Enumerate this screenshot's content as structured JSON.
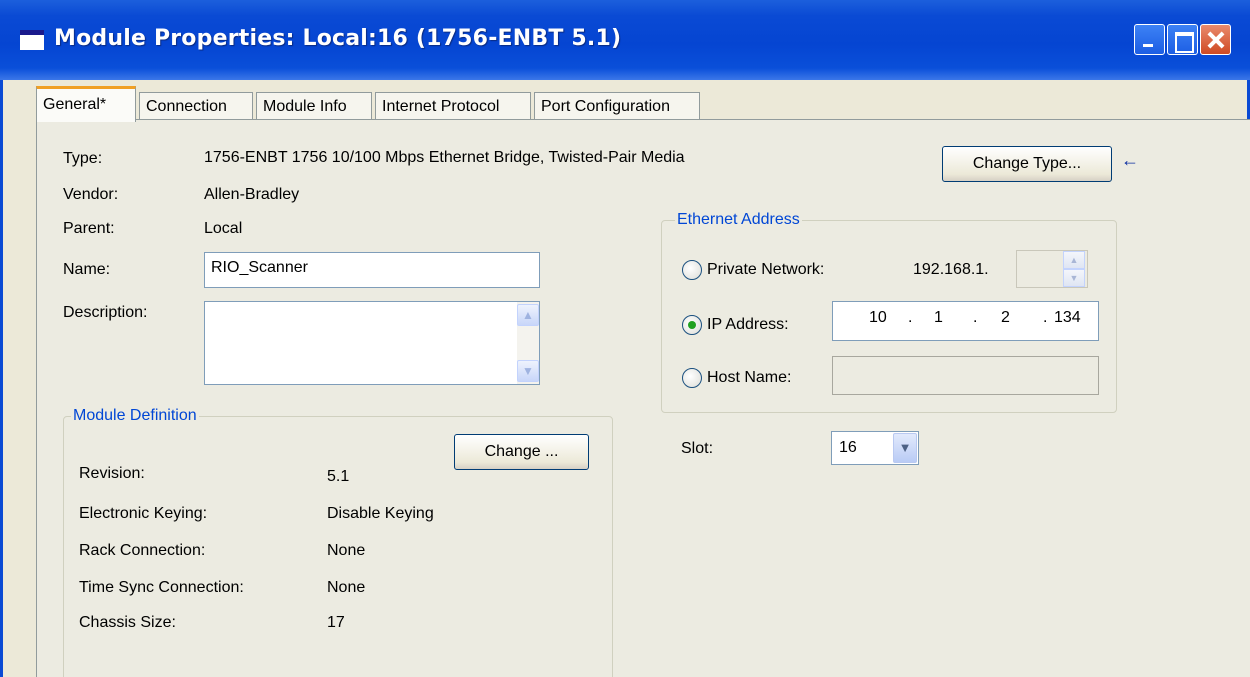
{
  "window": {
    "title": "Module Properties: Local:16 (1756-ENBT 5.1)"
  },
  "tabs": [
    {
      "label": "General*"
    },
    {
      "label": "Connection"
    },
    {
      "label": "Module Info"
    },
    {
      "label": "Internet Protocol"
    },
    {
      "label": "Port Configuration"
    }
  ],
  "general": {
    "type_label": "Type:",
    "type_value": "1756-ENBT 1756 10/100 Mbps Ethernet Bridge, Twisted-Pair Media",
    "vendor_label": "Vendor:",
    "vendor_value": "Allen-Bradley",
    "parent_label": "Parent:",
    "parent_value": "Local",
    "name_label": "Name:",
    "name_value": "RIO_Scanner",
    "description_label": "Description:",
    "description_value": "",
    "change_type_button": "Change Type...",
    "arrow_glyph": "←"
  },
  "module_definition": {
    "title": "Module Definition",
    "change_button": "Change ...",
    "rows": [
      {
        "label": "Revision:",
        "value": "5.1"
      },
      {
        "label": "Electronic Keying:",
        "value": "Disable Keying"
      },
      {
        "label": "Rack Connection:",
        "value": "None"
      },
      {
        "label": "Time Sync Connection:",
        "value": "None"
      },
      {
        "label": "Chassis Size:",
        "value": "17"
      }
    ]
  },
  "ethernet_address": {
    "title": "Ethernet Address",
    "private_network_label": "Private Network:",
    "private_network_prefix": "192.168.1.",
    "ip_address_label": "IP Address:",
    "ip_octets": [
      "10",
      "1",
      "2",
      "134"
    ],
    "ip_dot": ".",
    "host_name_label": "Host Name:",
    "selected": "ip_address"
  },
  "slot": {
    "label": "Slot:",
    "value": "16"
  },
  "colors": {
    "titlebar": "#0a4ad4",
    "group_title": "#0046d5",
    "tab_active_accent": "#f0a025"
  }
}
